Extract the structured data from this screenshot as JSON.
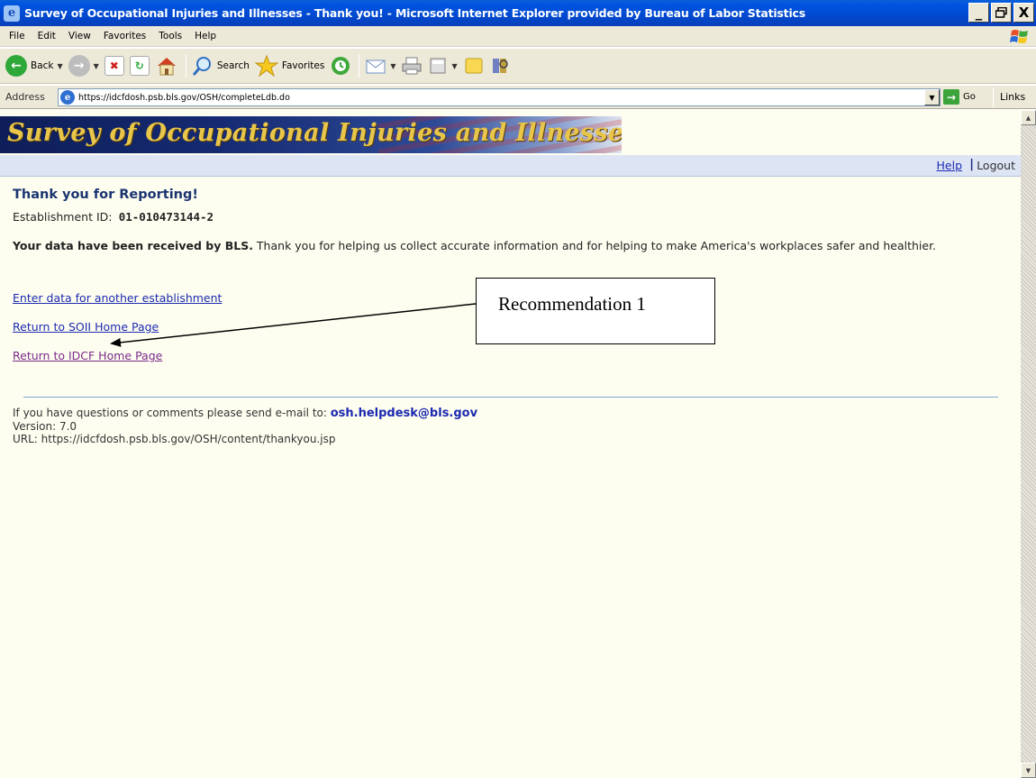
{
  "window": {
    "title": "Survey of Occupational Injuries and Illnesses - Thank you! - Microsoft Internet Explorer provided by Bureau of Labor Statistics",
    "minimize_glyph": "_",
    "maximize_glyph": "х",
    "close_glyph": "X"
  },
  "menu": [
    "File",
    "Edit",
    "View",
    "Favorites",
    "Tools",
    "Help"
  ],
  "toolbar": {
    "back_label": "Back",
    "search_label": "Search",
    "favorites_label": "Favorites"
  },
  "address": {
    "label": "Address",
    "url": "https://idcfdosh.psb.bls.gov/OSH/completeLdb.do",
    "go_label": "Go",
    "links_label": "Links"
  },
  "page": {
    "banner_title": "Survey of Occupational Injuries and Illnesses",
    "help_link": "Help",
    "separator": "|",
    "logout_link": "Logout",
    "heading": "Thank you for Reporting!",
    "establishment_label": "Establishment ID:",
    "establishment_id": "01-010473144-2",
    "received_bold": "Your data have been received by BLS.",
    "received_rest": " Thank you for helping us collect accurate information and for helping to make America's workplaces safer and healthier.",
    "links": {
      "enter_another": "Enter data for another establishment",
      "soii_home": "Return to SOII Home Page",
      "idcf_home": "Return to IDCF Home Page"
    },
    "footer": {
      "questions": "If you have questions or comments please send e-mail to: ",
      "email": "osh.helpdesk@bls.gov",
      "version": "Version: 7.0",
      "url_line": "URL: https://idcfdosh.psb.bls.gov/OSH/content/thankyou.jsp"
    }
  },
  "annotation": {
    "callout_text": "Recommendation 1"
  }
}
